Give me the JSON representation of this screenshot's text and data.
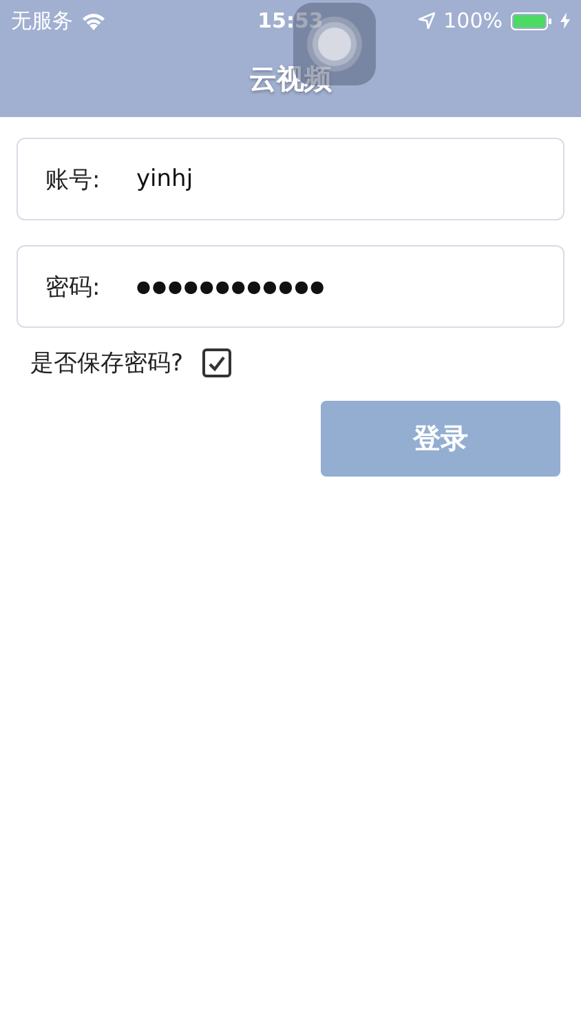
{
  "status_bar": {
    "carrier": "无服务",
    "time": "15:53",
    "battery": "100%"
  },
  "nav_bar": {
    "title": "云视频"
  },
  "fields": [
    {
      "label": "账号:",
      "value": "yinhj"
    },
    {
      "label": "密码:",
      "value": "●●●●●●●●●●●●"
    }
  ],
  "save_password": {
    "label": "是否保存密码?",
    "checked": true
  },
  "login_button": {
    "label": "登录"
  }
}
